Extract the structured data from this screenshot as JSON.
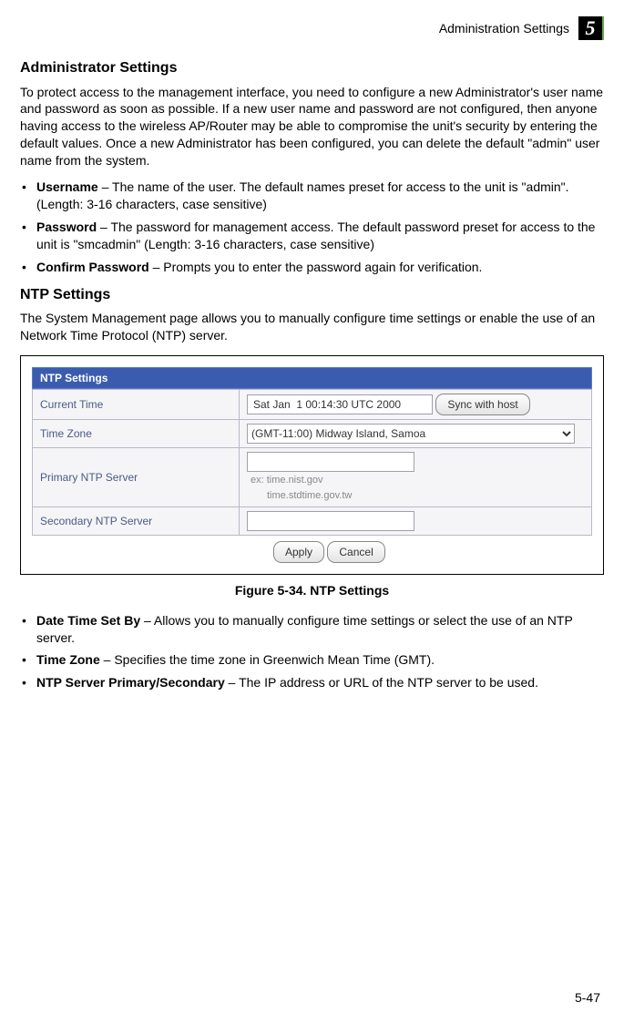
{
  "header": {
    "label": "Administration Settings",
    "chapter": "5"
  },
  "admin": {
    "heading": "Administrator Settings",
    "intro": "To protect access to the management interface, you need to configure a new Administrator's user name and password as soon as possible. If a new user name and password are not configured, then anyone having access to the wireless AP/Router may be able to compromise the unit's security by entering the default values. Once a new Administrator has been configured, you can delete the default \"admin\" user name from the system.",
    "items": [
      {
        "term": "Username",
        "text": " – The name of the user. The default names preset for access to the unit is \"admin\". (Length: 3-16 characters, case sensitive)"
      },
      {
        "term": "Password",
        "text": " – The password for management access. The default password preset for access to the unit is \"smcadmin\" (Length: 3-16 characters, case sensitive)"
      },
      {
        "term": "Confirm Password",
        "text": " – Prompts you to enter the password again for verification."
      }
    ]
  },
  "ntp": {
    "heading": "NTP Settings",
    "intro": "The System Management page allows you to manually configure time settings or enable the use of an Network Time Protocol (NTP) server.",
    "panel": {
      "title": "NTP Settings",
      "current_time_label": "Current Time",
      "current_time_value": "Sat Jan  1 00:14:30 UTC 2000",
      "sync_button": "Sync with host",
      "timezone_label": "Time Zone",
      "timezone_value": "(GMT-11:00) Midway Island, Samoa",
      "primary_label": "Primary NTP Server",
      "primary_value": "",
      "primary_hint1": "ex: time.nist.gov",
      "primary_hint2": "time.stdtime.gov.tw",
      "secondary_label": "Secondary NTP Server",
      "secondary_value": "",
      "apply": "Apply",
      "cancel": "Cancel"
    },
    "caption": "Figure 5-34.   NTP Settings",
    "items": [
      {
        "term": "Date Time Set By",
        "text": " – Allows you to manually configure time settings or select the use of an NTP server."
      },
      {
        "term": "Time Zone",
        "text": " – Specifies the time zone in Greenwich Mean Time (GMT)."
      },
      {
        "term": "NTP Server Primary/Secondary",
        "text": " – The IP address or URL of the NTP server to be used."
      }
    ]
  },
  "footer": {
    "page": "5-47"
  }
}
